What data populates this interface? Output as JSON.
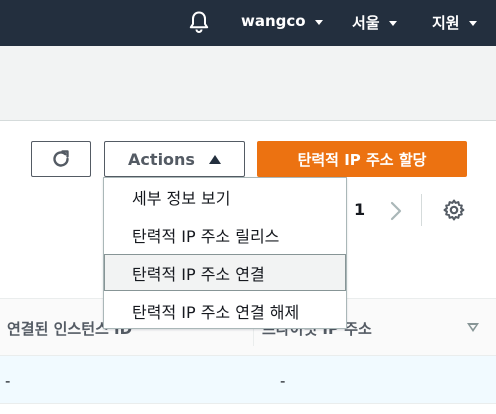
{
  "topbar": {
    "bell_icon": "bell-icon",
    "account_label": "wangco",
    "region_label": "서울",
    "support_label": "지원"
  },
  "toolbar": {
    "refresh_icon": "refresh-icon",
    "actions_label": "Actions",
    "allocate_label": "탄력적 IP 주소 할당"
  },
  "actions_menu": {
    "items": [
      {
        "label": "세부 정보 보기"
      },
      {
        "label": "탄력적 IP 주소 릴리스"
      },
      {
        "label": "탄력적 IP 주소 연결"
      },
      {
        "label": "탄력적 IP 주소 연결 해제"
      }
    ]
  },
  "pagination": {
    "current_page": "1"
  },
  "table": {
    "columns": [
      {
        "label": "연결된 인스턴스 ID"
      },
      {
        "label": "프라이빗 IP 주소"
      }
    ],
    "rows": [
      {
        "cells": [
          "-",
          "-"
        ]
      }
    ]
  },
  "colors": {
    "topbar": "#232f3e",
    "primary_button": "#ec7211",
    "selected_row": "#f1faff"
  }
}
